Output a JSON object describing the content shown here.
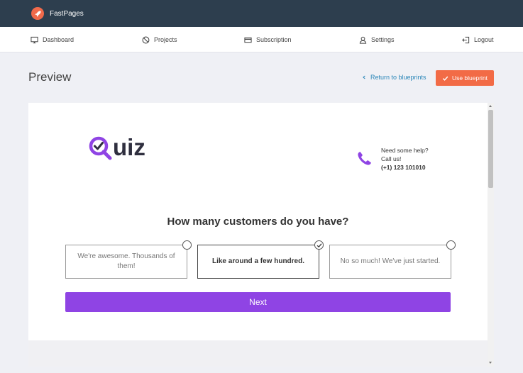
{
  "brand": {
    "name": "FastPages"
  },
  "nav": {
    "items": [
      {
        "label": "Dashboard",
        "icon": "monitor-icon"
      },
      {
        "label": "Projects",
        "icon": "ban-icon"
      },
      {
        "label": "Subscription",
        "icon": "credit-card-icon"
      },
      {
        "label": "Settings",
        "icon": "user-icon"
      },
      {
        "label": "Logout",
        "icon": "logout-icon"
      }
    ]
  },
  "header": {
    "title": "Preview",
    "return_label": "Return to blueprints",
    "use_label": "Use blueprint"
  },
  "quiz": {
    "logo_text": "uiz",
    "help_line1": "Need some help?",
    "help_line2": "Call us!",
    "phone": "(+1) 123 101010",
    "question": "How many customers do you have?",
    "options": [
      {
        "label": "We're awesome. Thousands of them!",
        "selected": false
      },
      {
        "label": "Like around a few hundred.",
        "selected": true
      },
      {
        "label": "No so much! We've just started.",
        "selected": false
      }
    ],
    "next_label": "Next"
  },
  "colors": {
    "topbar": "#2d3e4e",
    "accent_orange": "#f26b46",
    "accent_purple": "#8f44e4",
    "link_blue": "#2a86b8"
  }
}
